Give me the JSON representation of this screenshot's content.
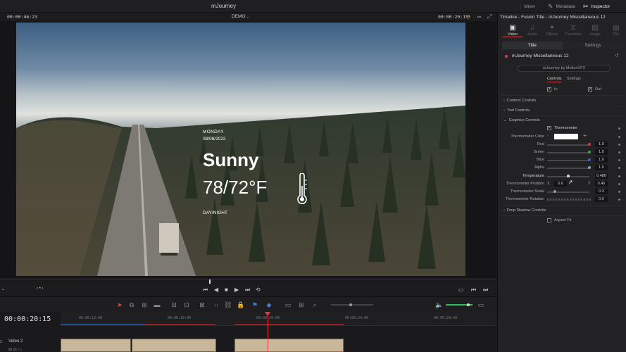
{
  "app": {
    "project_title": "mJourney",
    "top_right": [
      {
        "label": "Mixer",
        "icon": "mixer-icon"
      },
      {
        "label": "Metadata",
        "icon": "metadata-icon"
      },
      {
        "label": "Inspector",
        "icon": "inspector-icon"
      }
    ]
  },
  "viewer": {
    "left_timecode": "00:00:46:23",
    "clip_name": "DEMO",
    "right_timecode": "00:00:20:15"
  },
  "overlay": {
    "day": "MONDAY",
    "date": "08/08/2022",
    "condition": "Sunny",
    "temperature": "78/72°F",
    "day_night": "DAY/NIGHT"
  },
  "timeline": {
    "timecode": "00:00:20:15",
    "ruler": [
      "00:00:12:00",
      "00:00:16:00",
      "00:00:20:00",
      "00:00:24:00",
      "00:00:28:00"
    ],
    "track_number": "2",
    "track_name": "Video 2"
  },
  "inspector": {
    "header": "Timeline - Fusion Title - mJourney Miscellaneous 12",
    "tabs": [
      "Video",
      "Audio",
      "Effects",
      "Transition",
      "Image",
      "File"
    ],
    "active_tab": "Video",
    "segments": [
      "Title",
      "Settings"
    ],
    "node_name": "mJourney Miscellaneous 12",
    "credit": "mJourney by MotionVFX",
    "sub_tabs": [
      "Controls",
      "Settings"
    ],
    "in_label": "In",
    "out_label": "Out",
    "sections": {
      "content": "Content Controls",
      "text": "Text Controls",
      "graphics": "Graphics Controls",
      "drop_shadow": "Drop Shadow Controls"
    },
    "thermometer_toggle": "Thermometer",
    "params": [
      {
        "label": "Thermometer Color"
      },
      {
        "label": "Red",
        "value": "1.0",
        "color": "#d03a3a"
      },
      {
        "label": "Green",
        "value": "1.0",
        "color": "#3aa84a"
      },
      {
        "label": "Blue",
        "value": "1.0",
        "color": "#3a64d0"
      },
      {
        "label": "Alpha",
        "value": "1.0",
        "color": "#9a9a9a"
      },
      {
        "label": "Temperature",
        "value": "0.488"
      },
      {
        "label": "Thermometer Position",
        "x_label": "X",
        "x_value": "0.6",
        "y_label": "Y",
        "y_value": "0.45"
      },
      {
        "label": "Thermometer Scale",
        "value": "0.3"
      },
      {
        "label": "Thermometer  Rotation",
        "value": "0.0"
      }
    ],
    "aspect_fit": "Aspect Fit"
  }
}
